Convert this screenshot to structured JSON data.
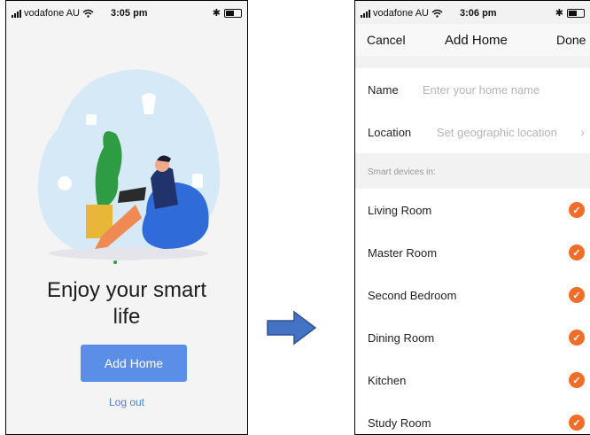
{
  "left": {
    "status": {
      "carrier": "vodafone AU",
      "time": "3:05 pm"
    },
    "headline": "Enjoy your smart life",
    "add_home_label": "Add Home",
    "logout_label": "Log out"
  },
  "right": {
    "status": {
      "carrier": "vodafone AU",
      "time": "3:06 pm"
    },
    "nav": {
      "cancel": "Cancel",
      "title": "Add Home",
      "done": "Done"
    },
    "name": {
      "label": "Name",
      "placeholder": "Enter your home name"
    },
    "location": {
      "label": "Location",
      "placeholder": "Set geographic location"
    },
    "section_label": "Smart devices in:",
    "rooms": [
      {
        "label": "Living Room",
        "checked": true
      },
      {
        "label": "Master Room",
        "checked": true
      },
      {
        "label": "Second Bedroom",
        "checked": true
      },
      {
        "label": "Dining Room",
        "checked": true
      },
      {
        "label": "Kitchen",
        "checked": true
      },
      {
        "label": "Study Room",
        "checked": true
      }
    ]
  },
  "colors": {
    "accent_blue": "#5b8ee6",
    "check_orange": "#f26d2a",
    "arrow_blue": "#4472c4"
  },
  "icons": [
    "wifi-icon",
    "bluetooth-icon",
    "battery-icon",
    "checkmark-icon",
    "chevron-right-icon",
    "arrow-right-icon"
  ]
}
